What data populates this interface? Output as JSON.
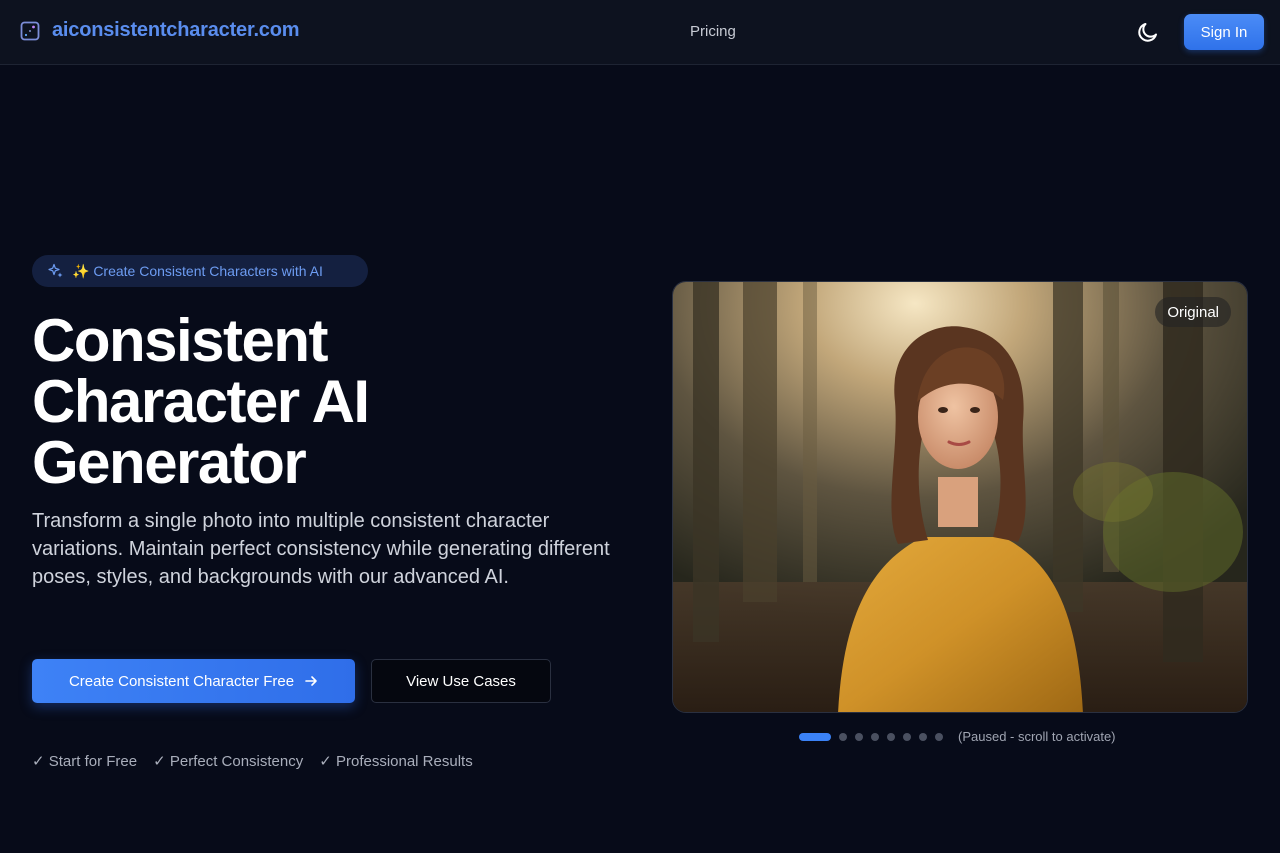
{
  "header": {
    "brand": "aiconsistentcharacter.com",
    "nav": {
      "pricing": "Pricing"
    },
    "sign_in": "Sign In",
    "icons": {
      "logo": "logo-icon",
      "theme_toggle": "moon-icon"
    }
  },
  "hero": {
    "badge_text": "✨ Create Consistent Characters with AI",
    "title_lines": [
      "Consistent",
      "Character AI",
      "Generator"
    ],
    "description": "Transform a single photo into multiple consistent character variations. Maintain perfect consistency while generating different poses, styles, and backgrounds with our advanced AI.",
    "primary_cta": "Create Consistent Character Free",
    "secondary_cta": "View Use Cases",
    "features": [
      "✓ Start for Free",
      "✓ Perfect Consistency",
      "✓ Professional Results"
    ]
  },
  "preview": {
    "image_label": "Original",
    "slide_count": 8,
    "active_slide": 1,
    "status": "(Paused - scroll to activate)"
  },
  "colors": {
    "accent": "#3b82f6",
    "brand_text": "#5a8dee",
    "background": "#070b19",
    "header_bg": "#0d121f"
  }
}
